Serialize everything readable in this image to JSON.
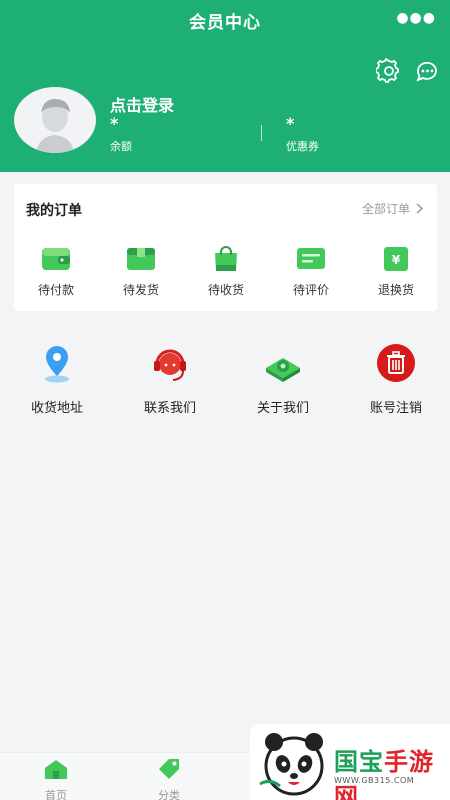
{
  "header": {
    "title": "会员中心",
    "more_icon": "more-dots-icon",
    "settings_icon": "gear-icon",
    "message_icon": "chat-bubble-icon",
    "login_text": "点击登录",
    "balance_value": "*",
    "balance_label": "余额",
    "coupon_value": "*",
    "coupon_label": "优惠券"
  },
  "orders": {
    "title": "我的订单",
    "all_label": "全部订单",
    "items": [
      {
        "label": "待付款",
        "icon": "wallet-icon"
      },
      {
        "label": "待发货",
        "icon": "box-icon"
      },
      {
        "label": "待收货",
        "icon": "shopping-bag-icon"
      },
      {
        "label": "待评价",
        "icon": "comment-card-icon"
      },
      {
        "label": "退换货",
        "icon": "yuan-return-icon"
      }
    ]
  },
  "services": [
    {
      "label": "收货地址",
      "icon": "location-pin-icon"
    },
    {
      "label": "联系我们",
      "icon": "customer-service-icon"
    },
    {
      "label": "关于我们",
      "icon": "about-gear-icon"
    },
    {
      "label": "账号注销",
      "icon": "trash-icon"
    }
  ],
  "tabbar": [
    {
      "label": "首页",
      "icon": "home-icon"
    },
    {
      "label": "分类",
      "icon": "tag-icon"
    }
  ],
  "watermark": {
    "text_part1": "国宝",
    "text_part2": "手游网",
    "url": "WWW.GB315.COM"
  },
  "colors": {
    "brand_green": "#1eaf74",
    "icon_green": "#43c95a",
    "danger_red": "#d71919"
  }
}
